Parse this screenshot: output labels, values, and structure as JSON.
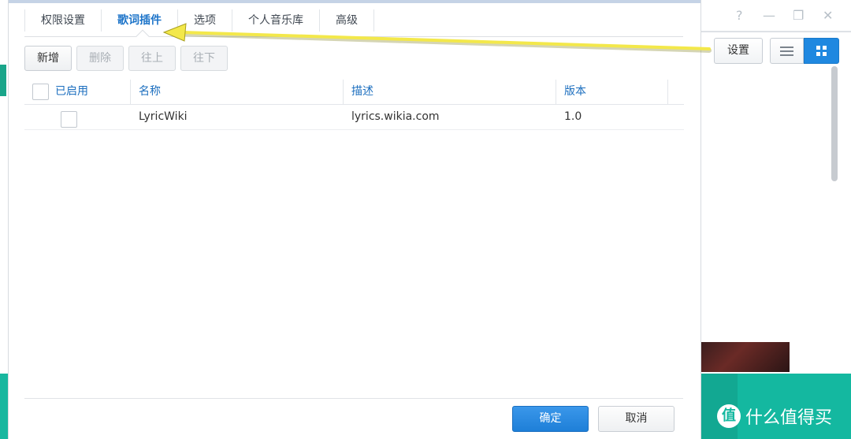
{
  "background_app": {
    "window_controls": [
      "?",
      "—",
      "❐",
      "✕"
    ],
    "settings_button": "设置",
    "view_list_icon": "list-icon",
    "view_grid_icon": "grid-icon",
    "watermark_badge": "值",
    "watermark_text": "什么值得买"
  },
  "dialog": {
    "tabs": [
      {
        "label": "权限设置",
        "active": false
      },
      {
        "label": "歌词插件",
        "active": true
      },
      {
        "label": "选项",
        "active": false
      },
      {
        "label": "个人音乐库",
        "active": false
      },
      {
        "label": "高级",
        "active": false
      }
    ],
    "actions": [
      {
        "label": "新增",
        "enabled": true
      },
      {
        "label": "删除",
        "enabled": false
      },
      {
        "label": "往上",
        "enabled": false
      },
      {
        "label": "往下",
        "enabled": false
      }
    ],
    "table": {
      "columns": [
        "已启用",
        "名称",
        "描述",
        "版本"
      ],
      "rows": [
        {
          "enabled": false,
          "name": "LyricWiki",
          "description": "lyrics.wikia.com",
          "version": "1.0"
        }
      ]
    },
    "ok_button": "确定",
    "cancel_button": "取消"
  },
  "colors": {
    "accent_blue": "#1f88e0",
    "active_tab": "#1d74c9",
    "teal": "#14b8a0",
    "annotation_arrow": "#f3e84a"
  }
}
